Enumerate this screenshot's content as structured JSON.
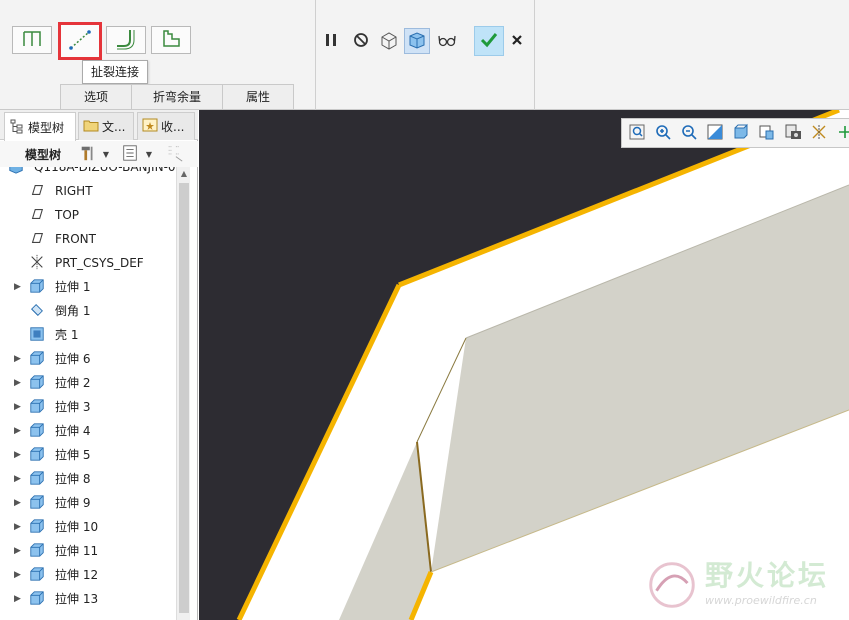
{
  "ribbon": {
    "tooltip": "扯裂连接",
    "tabs": [
      "选项",
      "折弯余量",
      "属性"
    ]
  },
  "left_panel": {
    "tabs": [
      "模型树",
      "文...",
      "收..."
    ],
    "toolbar_label": "模型树",
    "root_item": "Q118A-DIZUO-BANJIN-0",
    "items": [
      {
        "label": "RIGHT",
        "icon": "datum-plane-icon",
        "expandable": false
      },
      {
        "label": "TOP",
        "icon": "datum-plane-icon",
        "expandable": false
      },
      {
        "label": "FRONT",
        "icon": "datum-plane-icon",
        "expandable": false
      },
      {
        "label": "PRT_CSYS_DEF",
        "icon": "csys-icon",
        "expandable": false
      },
      {
        "label": "拉伸 1",
        "icon": "extrude-icon",
        "expandable": true
      },
      {
        "label": "倒角 1",
        "icon": "chamfer-icon",
        "expandable": false
      },
      {
        "label": "壳 1",
        "icon": "shell-icon",
        "expandable": false
      },
      {
        "label": "拉伸 6",
        "icon": "extrude-icon",
        "expandable": true
      },
      {
        "label": "拉伸 2",
        "icon": "extrude-icon",
        "expandable": true
      },
      {
        "label": "拉伸 3",
        "icon": "extrude-icon",
        "expandable": true
      },
      {
        "label": "拉伸 4",
        "icon": "extrude-icon",
        "expandable": true
      },
      {
        "label": "拉伸 5",
        "icon": "extrude-icon",
        "expandable": true
      },
      {
        "label": "拉伸 8",
        "icon": "extrude-icon",
        "expandable": true
      },
      {
        "label": "拉伸 9",
        "icon": "extrude-icon",
        "expandable": true
      },
      {
        "label": "拉伸 10",
        "icon": "extrude-icon",
        "expandable": true
      },
      {
        "label": "拉伸 11",
        "icon": "extrude-icon",
        "expandable": true
      },
      {
        "label": "拉伸 12",
        "icon": "extrude-icon",
        "expandable": true
      },
      {
        "label": "拉伸 13",
        "icon": "extrude-icon",
        "expandable": true
      }
    ]
  },
  "watermark": {
    "title": "野火论坛",
    "url": "www.proewildfire.cn"
  },
  "colors": {
    "viewport_bg": "#2d2c32",
    "edge_highlight": "#f5b400",
    "surface": "#d3d2c9",
    "accent_red": "#e5343a"
  }
}
